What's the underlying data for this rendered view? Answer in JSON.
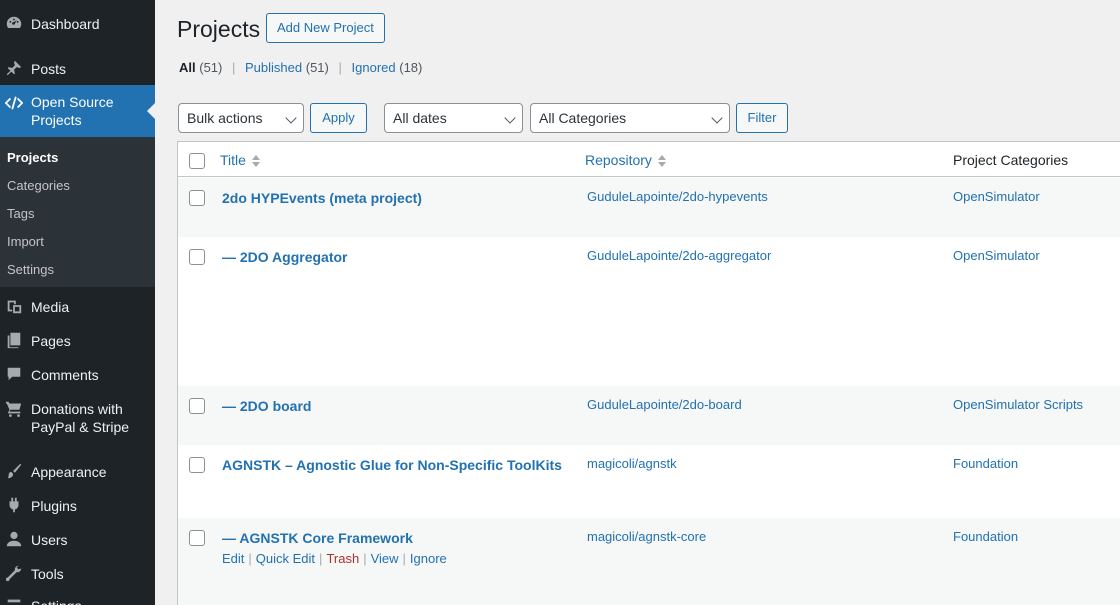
{
  "sidebar": {
    "items": [
      {
        "label": "Dashboard",
        "icon": "dashboard-icon"
      },
      {
        "label": "Posts",
        "icon": "pin-icon"
      },
      {
        "label": "Open Source\nProjects",
        "icon": "code-icon"
      },
      {
        "label": "Media",
        "icon": "media-icon"
      },
      {
        "label": "Pages",
        "icon": "pages-icon"
      },
      {
        "label": "Comments",
        "icon": "comments-icon"
      },
      {
        "label": "Donations with\nPayPal & Stripe",
        "icon": "cart-icon"
      },
      {
        "label": "Appearance",
        "icon": "brush-icon"
      },
      {
        "label": "Plugins",
        "icon": "plugin-icon"
      },
      {
        "label": "Users",
        "icon": "user-icon"
      },
      {
        "label": "Tools",
        "icon": "wrench-icon"
      },
      {
        "label": "Settings",
        "icon": "settings-icon"
      }
    ],
    "submenu": [
      "Projects",
      "Categories",
      "Tags",
      "Import",
      "Settings"
    ]
  },
  "header": {
    "title": "Projects",
    "add_new": "Add New Project"
  },
  "views": {
    "all": "All",
    "all_count": "(51)",
    "published": "Published",
    "published_count": "(51)",
    "ignored": "Ignored",
    "ignored_count": "(18)",
    "sep": "|"
  },
  "filters": {
    "bulk_actions": "Bulk actions",
    "apply": "Apply",
    "dates": "All dates",
    "categories": "All Categories",
    "filter": "Filter"
  },
  "table": {
    "columns": [
      "Title",
      "Repository",
      "Project Categories"
    ],
    "rows": [
      {
        "title": "2do HYPEvents (meta project)",
        "repo": "GuduleLapointe/2do-hypevents",
        "category": "OpenSimulator"
      },
      {
        "title": "— 2DO Aggregator",
        "repo": "GuduleLapointe/2do-aggregator",
        "category": "OpenSimulator"
      },
      {
        "title": "— 2DO board",
        "repo": "GuduleLapointe/2do-board",
        "category": "OpenSimulator Scripts"
      },
      {
        "title": "AGNSTK – Agnostic Glue for Non-Specific ToolKits",
        "repo": "magicoli/agnstk",
        "category": "Foundation"
      },
      {
        "title": "— AGNSTK Core Framework",
        "repo": "magicoli/agnstk-core",
        "category": "Foundation"
      }
    ],
    "row_actions": [
      "Edit",
      "Quick Edit",
      "Trash",
      "View",
      "Ignore"
    ],
    "action_sep": "|"
  }
}
